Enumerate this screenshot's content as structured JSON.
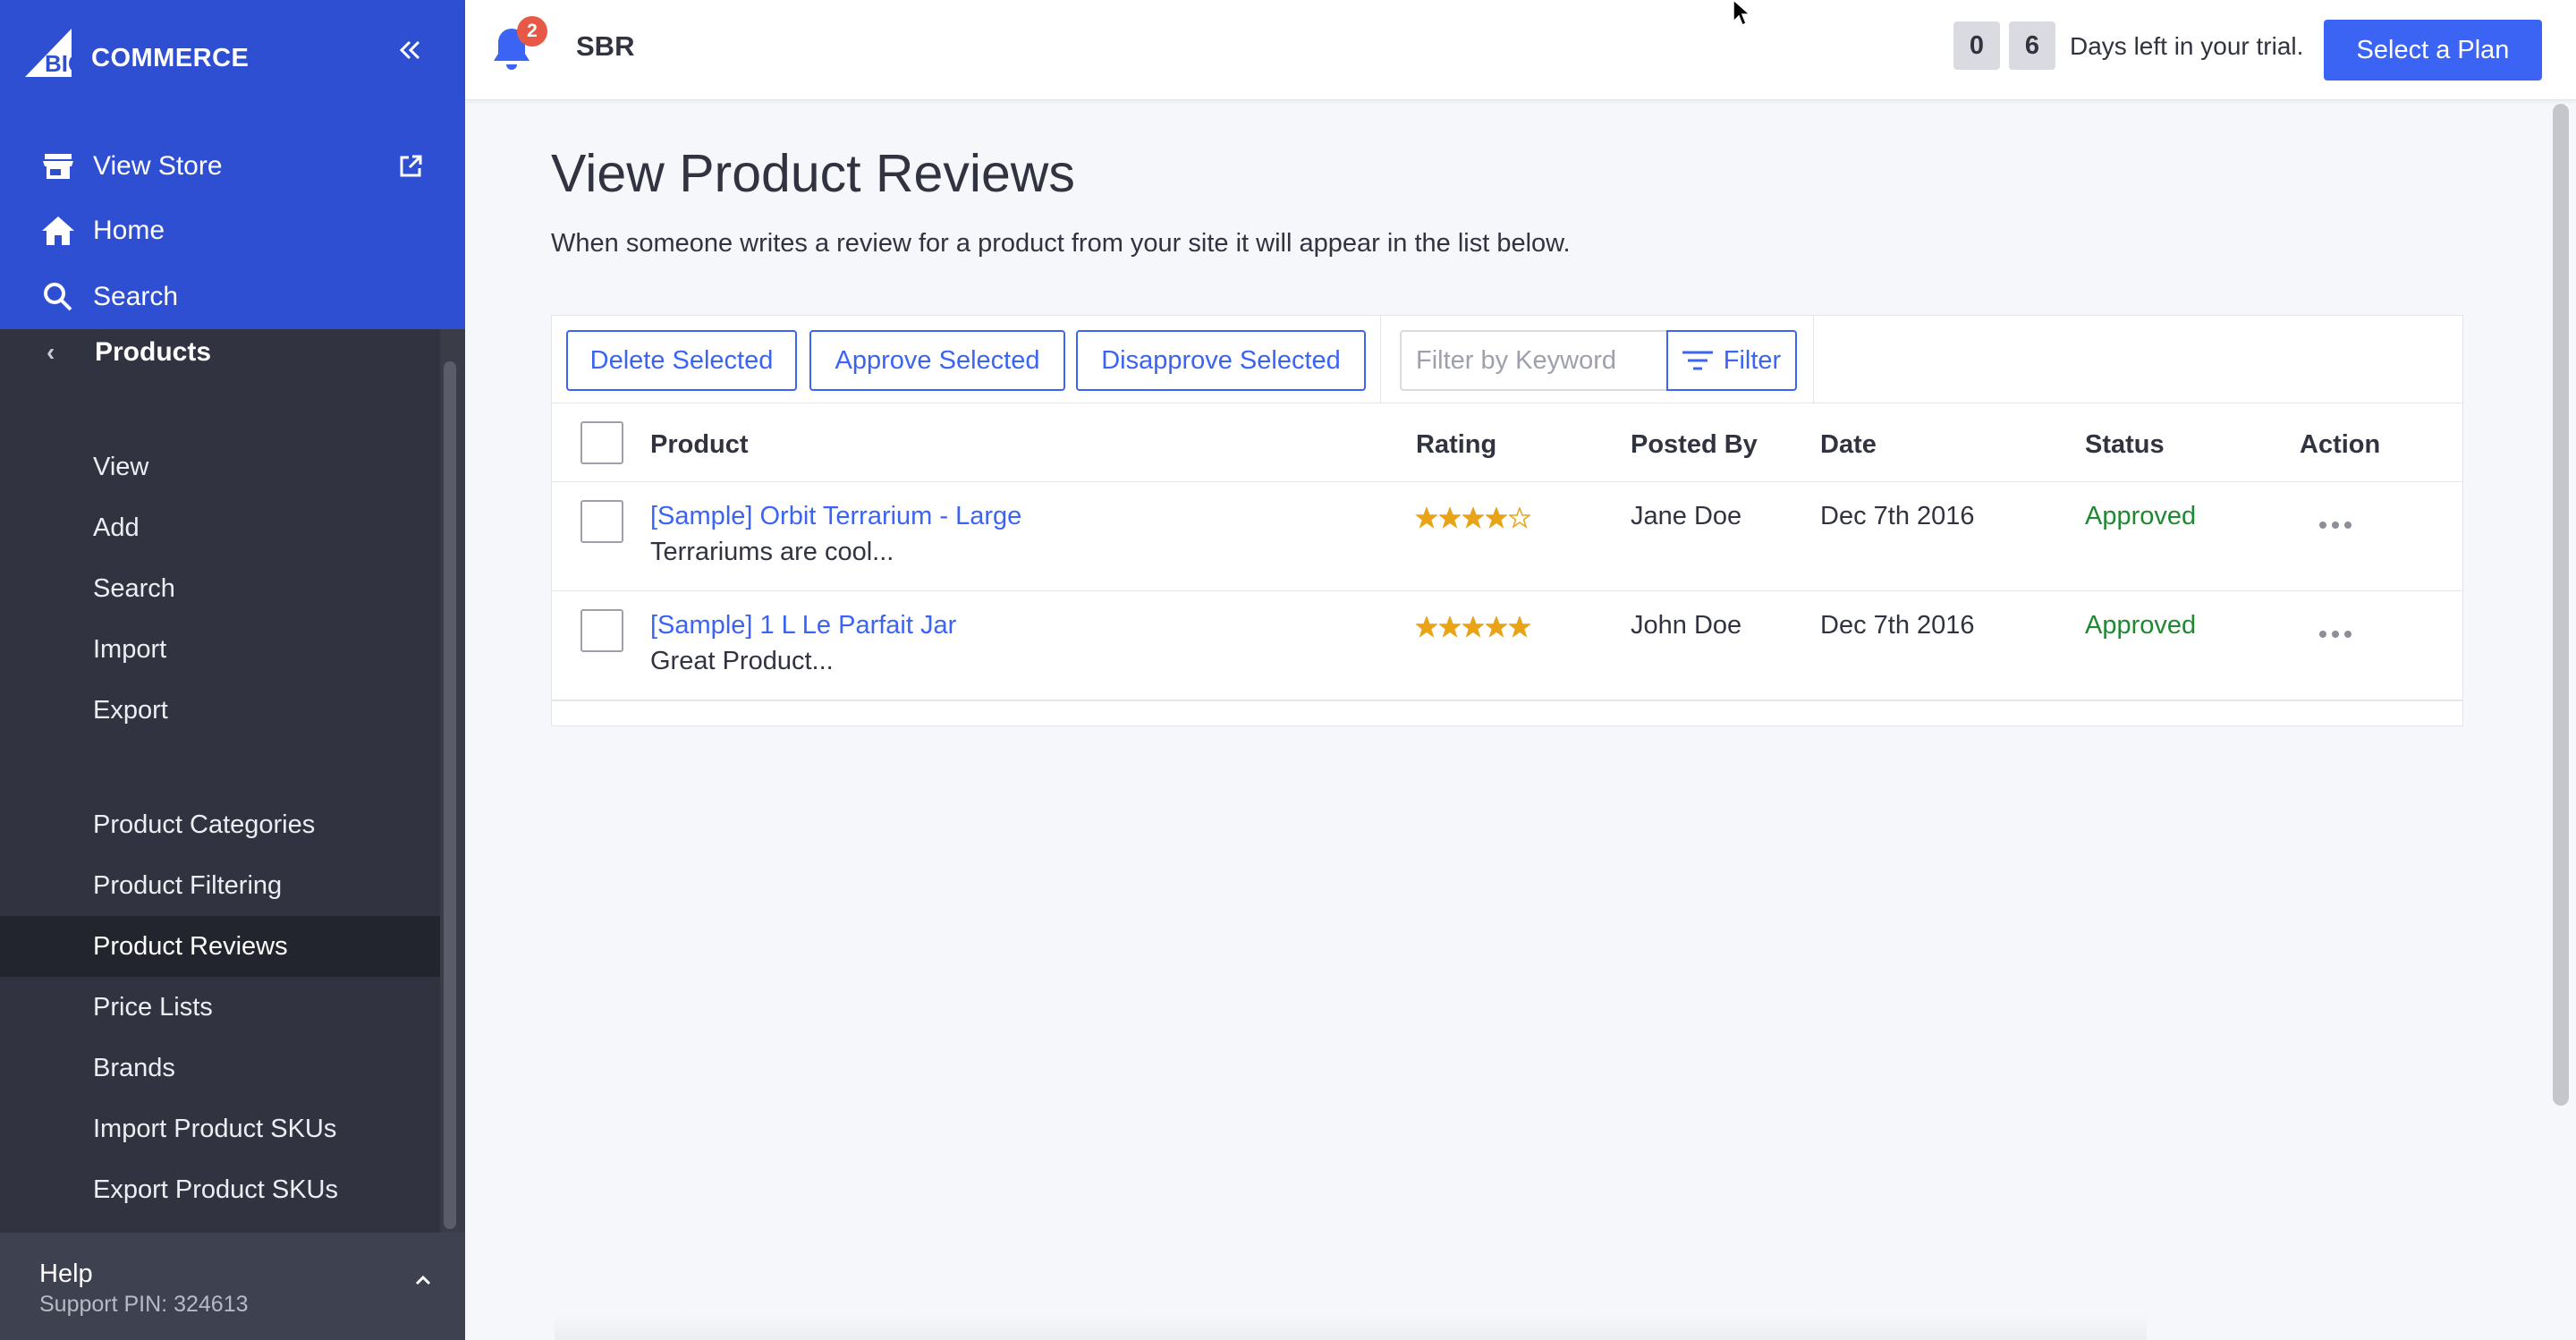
{
  "brand": {
    "logo_text": "COMMERCE",
    "logo_mark": "BIG"
  },
  "sidebar": {
    "top_items": [
      {
        "label": "View Store",
        "icon": "store-icon"
      },
      {
        "label": "Home",
        "icon": "home-icon"
      },
      {
        "label": "Search",
        "icon": "search-icon"
      }
    ],
    "section": "Products",
    "items": [
      {
        "label": "View"
      },
      {
        "label": "Add"
      },
      {
        "label": "Search"
      },
      {
        "label": "Import"
      },
      {
        "label": "Export"
      },
      {
        "label": "Product Categories"
      },
      {
        "label": "Product Filtering"
      },
      {
        "label": "Product Reviews",
        "active": true
      },
      {
        "label": "Price Lists"
      },
      {
        "label": "Brands"
      },
      {
        "label": "Import Product SKUs"
      },
      {
        "label": "Export Product SKUs"
      }
    ],
    "help": {
      "title": "Help",
      "pin": "Support PIN: 324613"
    }
  },
  "header": {
    "notification_count": "2",
    "store_name": "SBR",
    "trial_digits": [
      "0",
      "6"
    ],
    "trial_text": "Days left in your trial.",
    "plan_button": "Select a Plan"
  },
  "page": {
    "title": "View Product Reviews",
    "description": "When someone writes a review for a product from your site it will appear in the list below."
  },
  "toolbar": {
    "delete_label": "Delete Selected",
    "approve_label": "Approve Selected",
    "disapprove_label": "Disapprove Selected",
    "filter_placeholder": "Filter by Keyword",
    "filter_label": "Filter"
  },
  "table": {
    "columns": [
      "Product",
      "Rating",
      "Posted By",
      "Date",
      "Status",
      "Action"
    ],
    "rows": [
      {
        "product": "[Sample] Orbit Terrarium - Large",
        "excerpt": "Terrariums are cool...",
        "rating": 4,
        "posted_by": "Jane Doe",
        "date": "Dec 7th 2016",
        "status": "Approved"
      },
      {
        "product": "[Sample] 1 L Le Parfait Jar",
        "excerpt": "Great Product...",
        "rating": 5,
        "posted_by": "John Doe",
        "date": "Dec 7th 2016",
        "status": "Approved"
      }
    ]
  },
  "colors": {
    "accent": "#3c64f4",
    "sidebar_top": "#2e4fd1",
    "sidebar": "#313440",
    "approved": "#208831",
    "star": "#e8a317"
  }
}
